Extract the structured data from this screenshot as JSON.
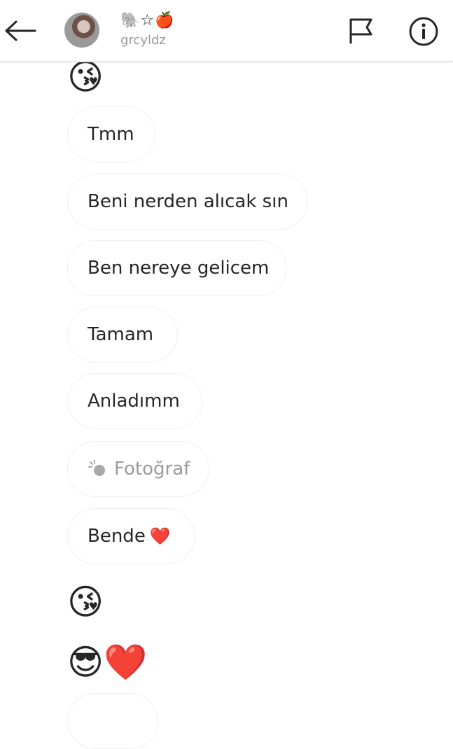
{
  "header": {
    "title_emoji": "🐘☆🍎",
    "username": "grcyldz"
  },
  "messages": [
    {
      "type": "emoji",
      "content": "😘"
    },
    {
      "type": "text",
      "content": "Tmm"
    },
    {
      "type": "text",
      "content": "Beni nerden alıcak sın"
    },
    {
      "type": "text",
      "content": "Ben nereye gelicem"
    },
    {
      "type": "text",
      "content": "Tamam"
    },
    {
      "type": "text",
      "content": "Anladımm"
    },
    {
      "type": "photo",
      "content": "Fotoğraf"
    },
    {
      "type": "text",
      "content": "Bende",
      "suffix": "❤️"
    },
    {
      "type": "emoji",
      "content": "😘"
    },
    {
      "type": "emoji",
      "content": "😎❤️"
    }
  ],
  "colors": {
    "bubble_border": "#efefef",
    "text": "#262626",
    "muted": "#999999",
    "heart": "#e8343e"
  },
  "icons": {
    "back": "arrow-left-icon",
    "flag": "flag-icon",
    "info": "info-icon",
    "photo": "photo-icon"
  }
}
